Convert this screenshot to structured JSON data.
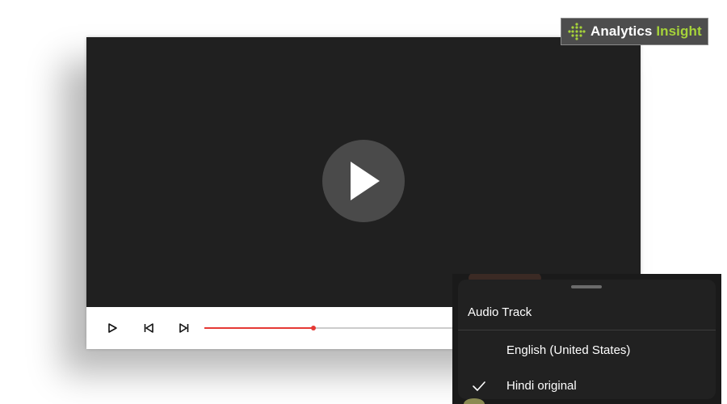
{
  "logo": {
    "text_main": "Analytics ",
    "text_accent": "Insight",
    "accent_color": "#a6d33a"
  },
  "player": {
    "big_play_icon": "play-icon",
    "controls": {
      "play_icon": "play-outline-icon",
      "prev_icon": "skip-previous-icon",
      "next_icon": "skip-next-icon"
    },
    "progress_fraction": 0.25,
    "progress_color": "#e53935"
  },
  "audio_menu": {
    "title": "Audio Track",
    "options": [
      {
        "label": "English (United States)",
        "selected": false
      },
      {
        "label": "Hindi original",
        "selected": true
      }
    ]
  }
}
